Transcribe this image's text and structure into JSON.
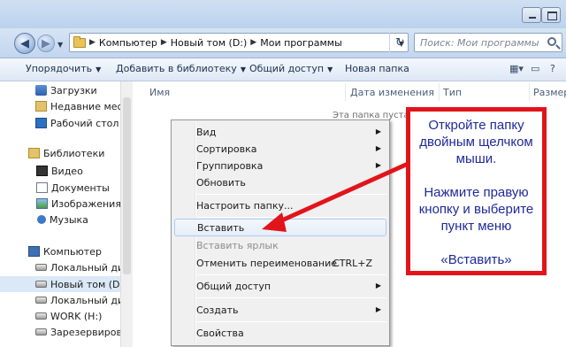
{
  "address": {
    "crumbs": [
      "Компьютер",
      "Новый том (D:)",
      "Мои программы"
    ]
  },
  "search": {
    "placeholder": "Поиск: Мои программы"
  },
  "toolbar": {
    "organize": "Упорядочить",
    "add_library": "Добавить в библиотеку",
    "share": "Общий доступ",
    "new_folder": "Новая папка"
  },
  "navpane": {
    "items": [
      {
        "label": "Загрузки",
        "icon": "downloads-icon"
      },
      {
        "label": "Недавние места",
        "icon": "recent-places-icon"
      },
      {
        "label": "Рабочий стол",
        "icon": "desktop-icon"
      },
      {
        "label": "Библиотеки",
        "icon": "libraries-icon"
      },
      {
        "label": "Видео",
        "icon": "video-icon"
      },
      {
        "label": "Документы",
        "icon": "documents-icon"
      },
      {
        "label": "Изображения",
        "icon": "images-icon"
      },
      {
        "label": "Музыка",
        "icon": "music-icon"
      },
      {
        "label": "Компьютер",
        "icon": "computer-icon"
      },
      {
        "label": "Локальный диск",
        "icon": "drive-icon"
      },
      {
        "label": "Новый том (D:)",
        "icon": "drive-icon",
        "selected": true
      },
      {
        "label": "Локальный диск",
        "icon": "drive-icon"
      },
      {
        "label": "WORK (H:)",
        "icon": "drive-icon"
      },
      {
        "label": "Зарезервирован",
        "icon": "drive-icon"
      }
    ]
  },
  "columns": [
    "Имя",
    "Дата изменения",
    "Тип",
    "Размер"
  ],
  "empty_text": "Эта папка пуста.",
  "context_menu": {
    "items": [
      {
        "label": "Вид",
        "submenu": true
      },
      {
        "label": "Сортировка",
        "submenu": true
      },
      {
        "label": "Группировка",
        "submenu": true
      },
      {
        "label": "Обновить"
      },
      {
        "label": "Настроить папку..."
      },
      {
        "label": "Вставить",
        "highlighted": true
      },
      {
        "label": "Вставить ярлык",
        "disabled": true
      },
      {
        "label": "Отменить переименование",
        "shortcut": "CTRL+Z"
      },
      {
        "label": "Общий доступ",
        "submenu": true
      },
      {
        "label": "Создать",
        "submenu": true
      },
      {
        "label": "Свойства"
      }
    ]
  },
  "annotation": {
    "lines": [
      "Откройте папку",
      "двойным щелчком",
      "мыши.",
      "",
      "Нажмите правую",
      "кнопку и выберите",
      "пункт   меню",
      "",
      "«Вставить»"
    ],
    "border_color": "#e2141b",
    "text_color": "#1f2a9b"
  }
}
